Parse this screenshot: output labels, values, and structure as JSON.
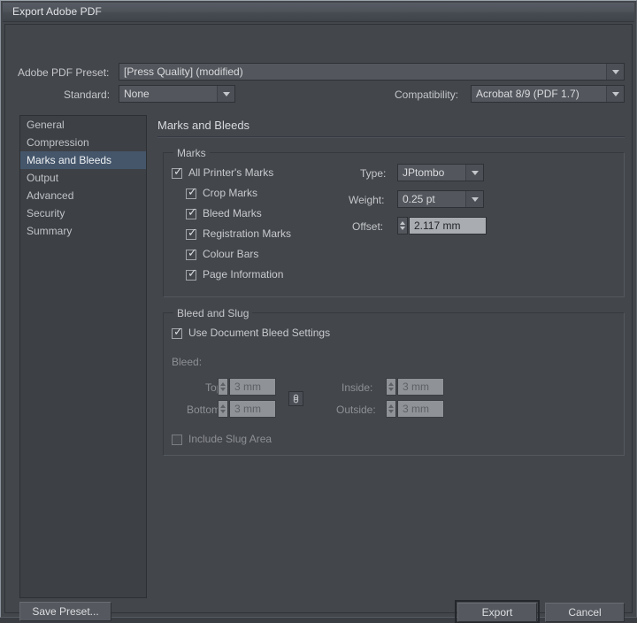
{
  "window": {
    "title": "Export Adobe PDF"
  },
  "top": {
    "preset_label": "Adobe PDF Preset:",
    "preset_value": "[Press Quality] (modified)",
    "standard_label": "Standard:",
    "standard_value": "None",
    "compatibility_label": "Compatibility:",
    "compatibility_value": "Acrobat 8/9 (PDF 1.7)"
  },
  "sidebar": {
    "items": [
      {
        "label": "General",
        "selected": false
      },
      {
        "label": "Compression",
        "selected": false
      },
      {
        "label": "Marks and Bleeds",
        "selected": true
      },
      {
        "label": "Output",
        "selected": false
      },
      {
        "label": "Advanced",
        "selected": false
      },
      {
        "label": "Security",
        "selected": false
      },
      {
        "label": "Summary",
        "selected": false
      }
    ]
  },
  "panel": {
    "title": "Marks and Bleeds"
  },
  "marks": {
    "group_label": "Marks",
    "all_printers_marks": {
      "label": "All Printer's Marks",
      "checked": true
    },
    "items": [
      {
        "label": "Crop Marks",
        "checked": true
      },
      {
        "label": "Bleed Marks",
        "checked": true
      },
      {
        "label": "Registration Marks",
        "checked": true
      },
      {
        "label": "Colour Bars",
        "checked": true
      },
      {
        "label": "Page Information",
        "checked": true
      }
    ],
    "type_label": "Type:",
    "type_value": "JPtombo",
    "weight_label": "Weight:",
    "weight_value": "0.25 pt",
    "offset_label": "Offset:",
    "offset_value": "2.117 mm"
  },
  "bleed": {
    "group_label": "Bleed and Slug",
    "use_document_bleed": {
      "label": "Use Document Bleed Settings",
      "checked": true
    },
    "bleed_label": "Bleed:",
    "top_label": "Top:",
    "top_value": "3 mm",
    "bottom_label": "Bottom:",
    "bottom_value": "3 mm",
    "inside_label": "Inside:",
    "inside_value": "3 mm",
    "outside_label": "Outside:",
    "outside_value": "3 mm",
    "link_icon": "chain-link-icon",
    "include_slug": {
      "label": "Include Slug Area",
      "checked": false
    }
  },
  "footer": {
    "save_preset": "Save Preset...",
    "export": "Export",
    "cancel": "Cancel"
  },
  "colors": {
    "window_bg": "#43464b",
    "selection": "#45566b",
    "text": "#c8cacd",
    "text_dim": "#8d9094",
    "field_bg": "#53565c",
    "field_light": "#a9acb0",
    "field_disabled": "#8f9398"
  },
  "icons": {
    "chevron_down": "chevron-down-icon",
    "spinner_up": "spinner-up-icon",
    "spinner_down": "spinner-down-icon"
  }
}
